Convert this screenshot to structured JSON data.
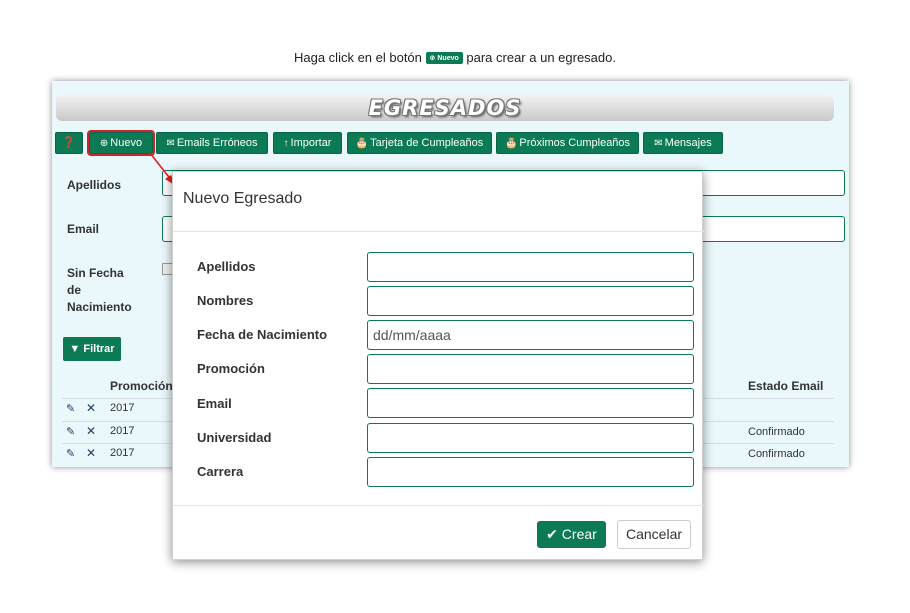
{
  "caption": {
    "before": "Haga click en el botón",
    "button_label": "Nuevo",
    "after": "para crear a un egresado."
  },
  "app": {
    "title": "EGRESADOS",
    "toolbar": {
      "help_icon": "question-circle-icon",
      "nuevo": "Nuevo",
      "emails_erroneos": "Emails Erróneos",
      "importar": "Importar",
      "tarjeta_cumpleanos": "Tarjeta de Cumpleaños",
      "proximos_cumpleanos": "Próximos Cumpleaños",
      "mensajes": "Mensajes"
    },
    "filters": {
      "apellidos_label": "Apellidos",
      "email_label": "Email",
      "sin_fecha_line1": "Sin Fecha",
      "sin_fecha_line2": "de",
      "sin_fecha_line3": "Nacimiento",
      "filtrar_label": "Filtrar"
    },
    "table": {
      "headers": {
        "promocion": "Promoción",
        "estado_email": "Estado Email"
      },
      "rows": [
        {
          "promocion": "2017",
          "estado_email": ""
        },
        {
          "promocion": "2017",
          "estado_email": "Confirmado"
        },
        {
          "promocion": "2017",
          "estado_email": "Confirmado"
        }
      ]
    }
  },
  "modal": {
    "title": "Nuevo Egresado",
    "fields": {
      "apellidos": {
        "label": "Apellidos",
        "value": ""
      },
      "nombres": {
        "label": "Nombres",
        "value": ""
      },
      "fecha_nacimiento": {
        "label": "Fecha de Nacimiento",
        "placeholder": "dd/mm/aaaa"
      },
      "promocion": {
        "label": "Promoción",
        "value": ""
      },
      "email": {
        "label": "Email",
        "value": ""
      },
      "universidad": {
        "label": "Universidad",
        "value": ""
      },
      "carrera": {
        "label": "Carrera",
        "value": ""
      }
    },
    "buttons": {
      "crear": "Crear",
      "cancelar": "Cancelar"
    }
  },
  "colors": {
    "primary": "#0b7a55",
    "highlight": "#d0242c",
    "app_background": "#eaf7fb"
  }
}
